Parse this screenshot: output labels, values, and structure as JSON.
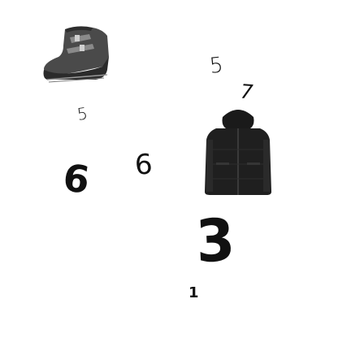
{
  "digits": {
    "top_right_5": "5",
    "top_right_7": "7",
    "left_5": "5",
    "left_6_large": "6",
    "center_6": "6",
    "bottom_3": "3",
    "bottom_1": "1"
  },
  "items": {
    "boot_icon": "wedge-ankle-boot-icon",
    "jacket_icon": "hooded-jacket-icon"
  },
  "colors": {
    "background": "#ffffff",
    "ink": "#111111",
    "boot_dark": "#3a3a3a",
    "boot_mid": "#6a6a6a",
    "jacket": "#1f1f1f"
  }
}
